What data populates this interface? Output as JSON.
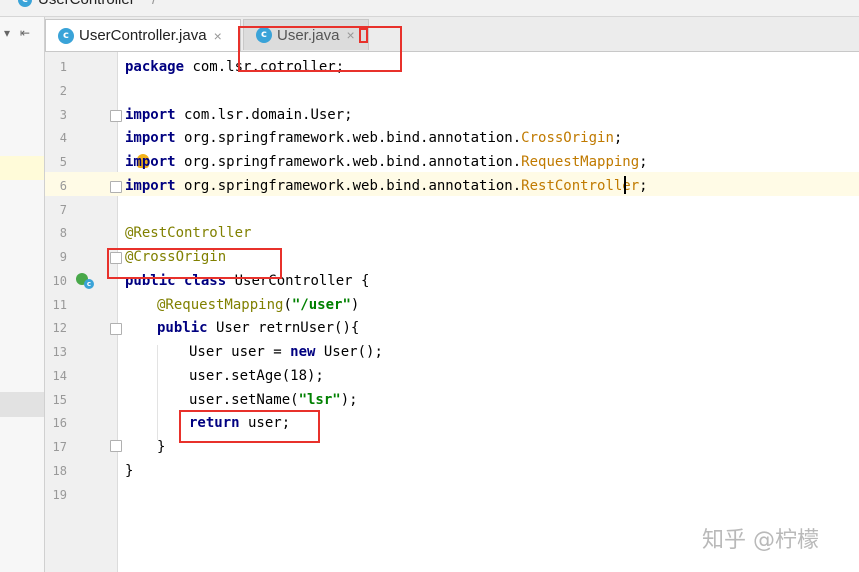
{
  "breadcrumb": {
    "class_name": "UserController"
  },
  "tabs": [
    {
      "label": "UserController.java",
      "icon": "class-icon",
      "active": true,
      "close": "×"
    },
    {
      "label": "User.java",
      "icon": "class-icon",
      "active": false,
      "close": "×"
    }
  ],
  "line_numbers": [
    "1",
    "2",
    "3",
    "4",
    "5",
    "6",
    "7",
    "8",
    "9",
    "10",
    "11",
    "12",
    "13",
    "14",
    "15",
    "16",
    "17",
    "18",
    "19"
  ],
  "code": {
    "l1": {
      "kw": "package",
      "rest": " com.lsr.cotroller;"
    },
    "l3": {
      "kw": "import",
      "rest": " com.lsr.domain.User;"
    },
    "l4": {
      "kw": "import",
      "pkg": " org.springframework.web.bind.annotation.",
      "cls": "CrossOrigin",
      "end": ";"
    },
    "l5": {
      "kw": "import",
      "pkg": " org.springframework.web.bind.annotation.",
      "cls": "RequestMapping",
      "end": ";"
    },
    "l6": {
      "kw": "import",
      "pkg": " org.springframework.web.bind.annotation.",
      "cls": "RestController",
      "end": ";"
    },
    "l8": {
      "ann": "@RestController"
    },
    "l9": {
      "ann": "@CrossOrigin"
    },
    "l10": {
      "kw": "public class",
      "rest": " UserController {"
    },
    "l11": {
      "ann": "@RequestMapping",
      "open": "(",
      "str": "\"/user\"",
      "close": ")"
    },
    "l12": {
      "kw": "public",
      "rest": " User retrnUser(){"
    },
    "l13": {
      "pre": "User user = ",
      "kw": "new",
      "rest": " User();"
    },
    "l14": {
      "text": "user.setAge(18);"
    },
    "l15": {
      "pre": "user.setName(",
      "str": "\"lsr\"",
      "rest": ");"
    },
    "l16": {
      "kw": "return",
      "rest": " user;"
    },
    "l17": {
      "text": "}"
    },
    "l18": {
      "text": "}"
    }
  },
  "watermark": "知乎 @柠檬",
  "colors": {
    "highlight": "#e8312b",
    "keyword": "#000080",
    "annotation": "#808000",
    "string": "#008000"
  }
}
